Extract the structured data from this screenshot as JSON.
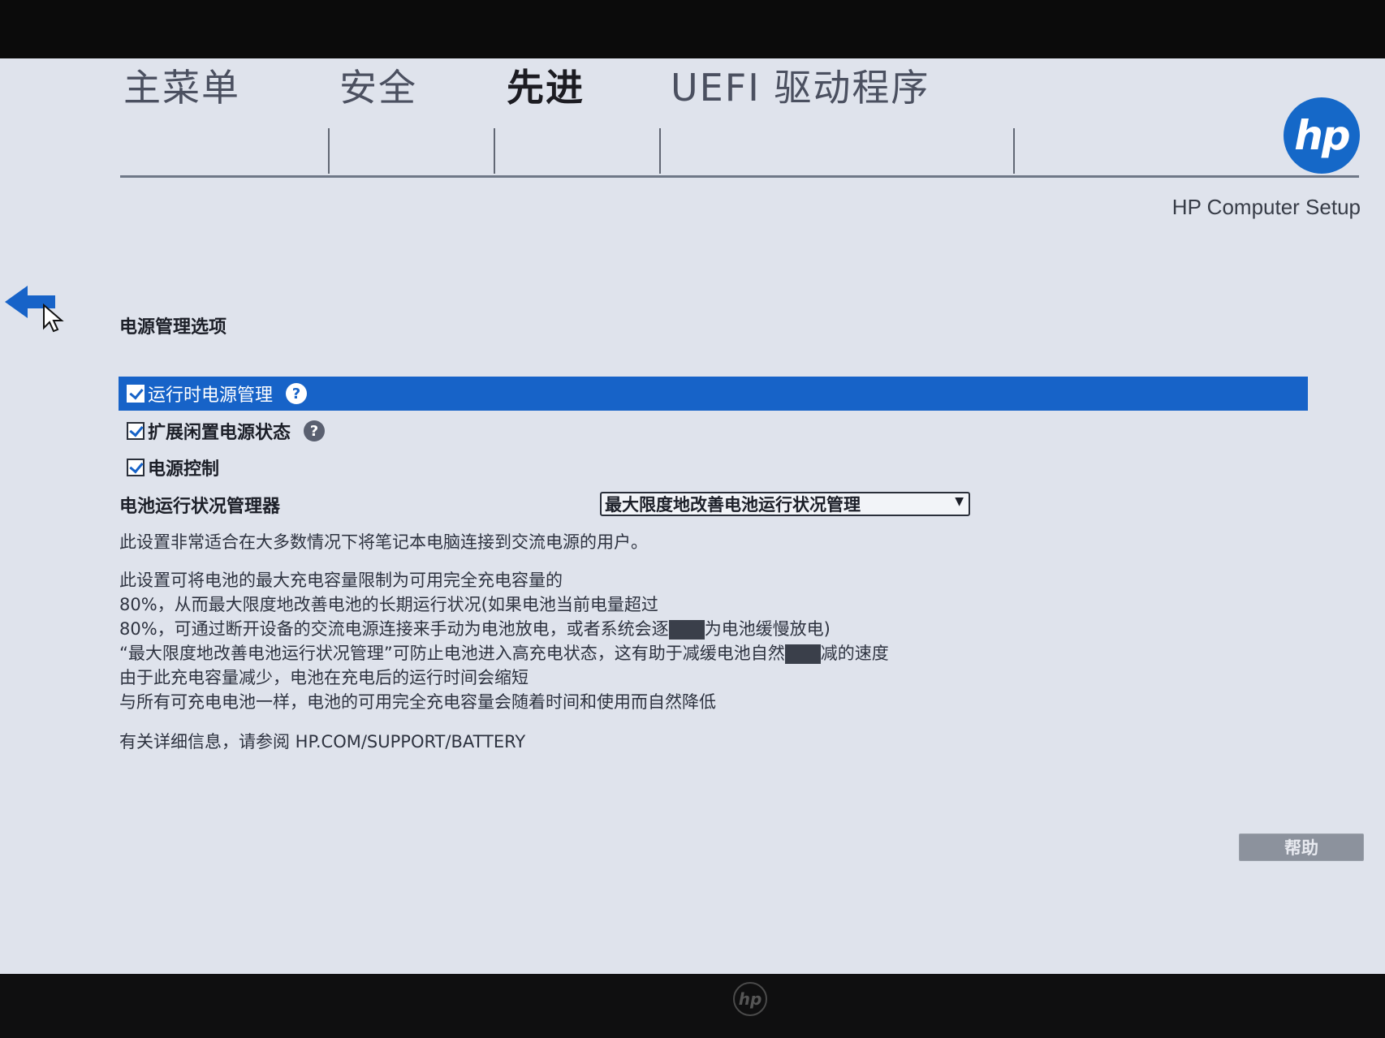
{
  "app": {
    "title": "HP Computer Setup",
    "logo_text": "hp"
  },
  "tabs": [
    {
      "label": "主菜单"
    },
    {
      "label": "安全"
    },
    {
      "label": "先进",
      "active": true
    },
    {
      "label": "UEFI 驱动程序"
    }
  ],
  "section": {
    "title": "电源管理选项"
  },
  "options": [
    {
      "label": "运行时电源管理",
      "checked": true,
      "selected": true,
      "help": "?"
    },
    {
      "label": "扩展闲置电源状态",
      "checked": true,
      "selected": false,
      "help": "?"
    },
    {
      "label": "电源控制",
      "checked": true,
      "selected": false
    }
  ],
  "battery": {
    "label": "电池运行状况管理器",
    "selected_value": "最大限度地改善电池运行状况管理"
  },
  "description": {
    "line1": "此设置非常适合在大多数情况下将笔记本电脑连接到交流电源的用户。",
    "line2": "此设置可将电池的最大充电容量限制为可用完全充电容量的",
    "line3": "80%，从而最大限度地改善电池的长期运行状况(如果电池当前电量超过",
    "line4a": "80%，可通过断开设备的交流电源连接来手动为电池放电，或者系统会逐",
    "line4b": "为电池缓慢放电)",
    "line5a": "“最大限度地改善电池运行状况管理”可防止电池进入高充电状态，这有助于减缓电池自然",
    "line5b": "减的速度",
    "line6": "由于此充电容量减少，电池在充电后的运行时间会缩短",
    "line7": "与所有可充电电池一样，电池的可用完全充电容量会随着时间和使用而自然降低",
    "line8": "有关详细信息，请参阅 HP.COM/SUPPORT/BATTERY"
  },
  "buttons": {
    "help": "帮助"
  },
  "colors": {
    "accent": "#1763c8",
    "background": "#dfe3ec"
  }
}
